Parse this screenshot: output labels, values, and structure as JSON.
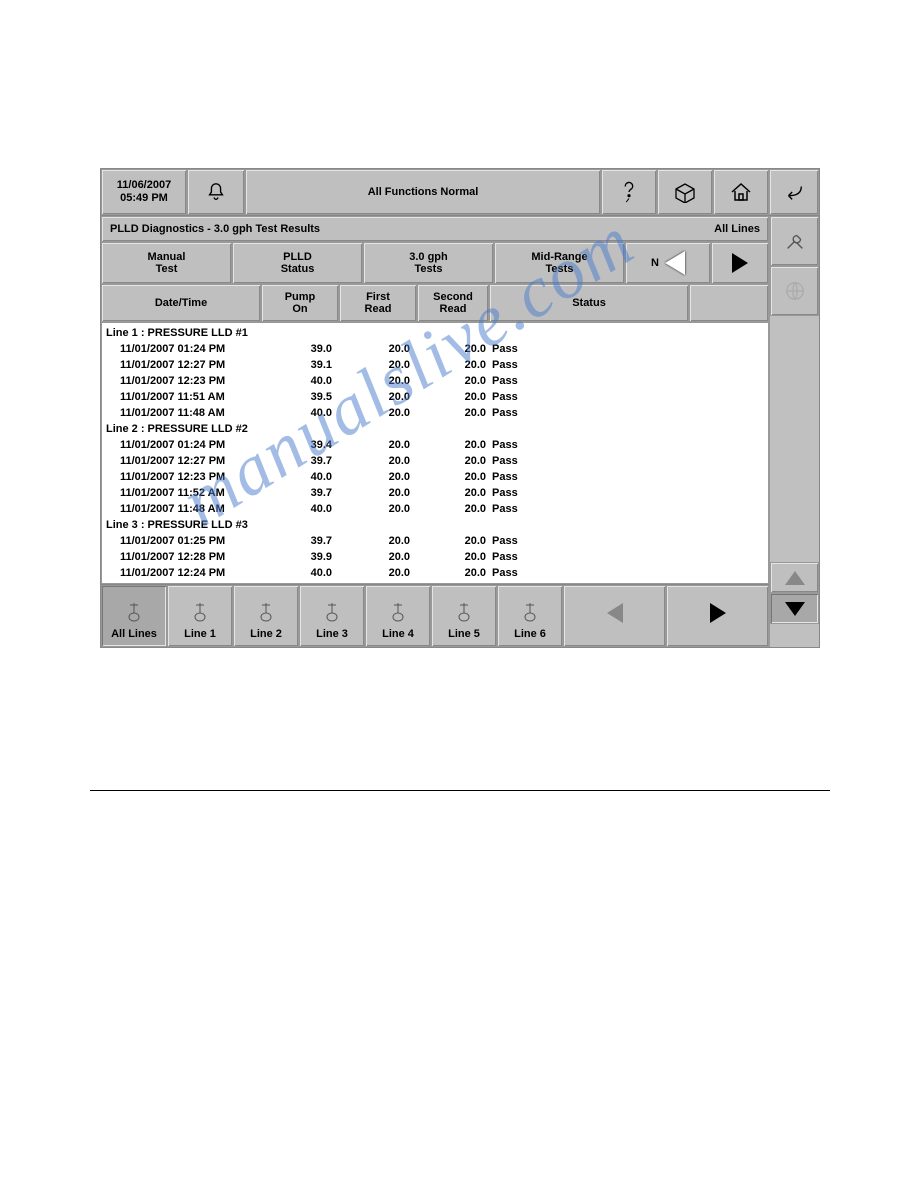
{
  "header": {
    "date": "11/06/2007",
    "time": "05:49 PM",
    "status": "All Functions Normal"
  },
  "titlebar": {
    "left": "PLLD Diagnostics - 3.0 gph Test Results",
    "right": "All Lines"
  },
  "tabs": [
    "Manual\nTest",
    "PLLD\nStatus",
    "3.0 gph\nTests",
    "Mid-Range\nTests",
    "N"
  ],
  "columns": [
    "Date/Time",
    "Pump\nOn",
    "First\nRead",
    "Second\nRead",
    "Status"
  ],
  "groups": [
    {
      "header": "Line 1 : PRESSURE LLD #1",
      "rows": [
        {
          "dt": "11/01/2007 01:24 PM",
          "pump": "39.0",
          "first": "20.0",
          "second": "20.0",
          "status": "Pass"
        },
        {
          "dt": "11/01/2007 12:27 PM",
          "pump": "39.1",
          "first": "20.0",
          "second": "20.0",
          "status": "Pass"
        },
        {
          "dt": "11/01/2007 12:23 PM",
          "pump": "40.0",
          "first": "20.0",
          "second": "20.0",
          "status": "Pass"
        },
        {
          "dt": "11/01/2007 11:51 AM",
          "pump": "39.5",
          "first": "20.0",
          "second": "20.0",
          "status": "Pass"
        },
        {
          "dt": "11/01/2007 11:48 AM",
          "pump": "40.0",
          "first": "20.0",
          "second": "20.0",
          "status": "Pass"
        }
      ]
    },
    {
      "header": "Line 2 : PRESSURE LLD #2",
      "rows": [
        {
          "dt": "11/01/2007 01:24 PM",
          "pump": "39.4",
          "first": "20.0",
          "second": "20.0",
          "status": "Pass"
        },
        {
          "dt": "11/01/2007 12:27 PM",
          "pump": "39.7",
          "first": "20.0",
          "second": "20.0",
          "status": "Pass"
        },
        {
          "dt": "11/01/2007 12:23 PM",
          "pump": "40.0",
          "first": "20.0",
          "second": "20.0",
          "status": "Pass"
        },
        {
          "dt": "11/01/2007 11:52 AM",
          "pump": "39.7",
          "first": "20.0",
          "second": "20.0",
          "status": "Pass"
        },
        {
          "dt": "11/01/2007 11:48 AM",
          "pump": "40.0",
          "first": "20.0",
          "second": "20.0",
          "status": "Pass"
        }
      ]
    },
    {
      "header": "Line 3 : PRESSURE LLD #3",
      "rows": [
        {
          "dt": "11/01/2007 01:25 PM",
          "pump": "39.7",
          "first": "20.0",
          "second": "20.0",
          "status": "Pass"
        },
        {
          "dt": "11/01/2007 12:28 PM",
          "pump": "39.9",
          "first": "20.0",
          "second": "20.0",
          "status": "Pass"
        },
        {
          "dt": "11/01/2007 12:24 PM",
          "pump": "40.0",
          "first": "20.0",
          "second": "20.0",
          "status": "Pass"
        }
      ]
    }
  ],
  "bottom": [
    "All Lines",
    "Line 1",
    "Line 2",
    "Line 3",
    "Line 4",
    "Line 5",
    "Line 6"
  ],
  "watermark": "manualslive.com"
}
